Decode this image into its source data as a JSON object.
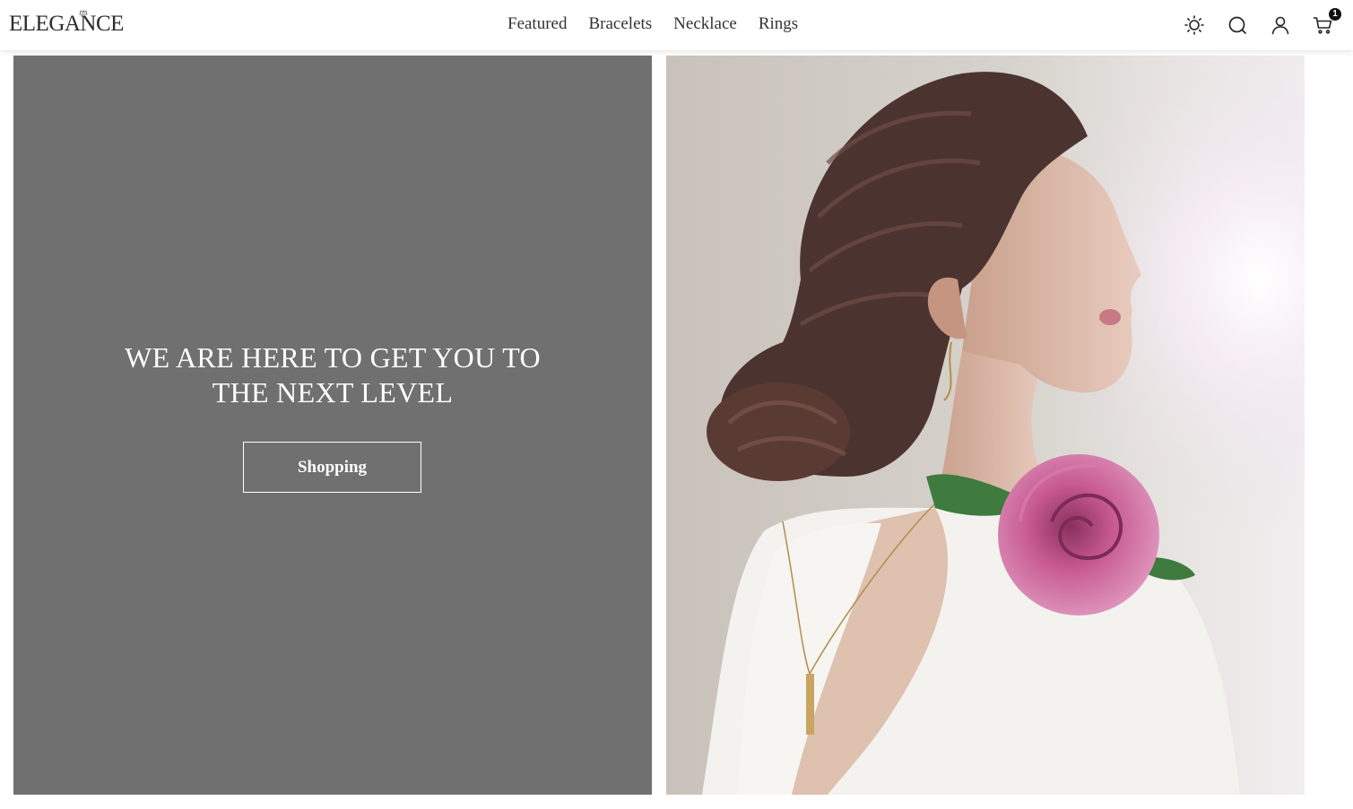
{
  "brand": {
    "logo_text": "ELEGANCE"
  },
  "nav": {
    "items": [
      {
        "label": "Featured"
      },
      {
        "label": "Bracelets"
      },
      {
        "label": "Necklace"
      },
      {
        "label": "Rings"
      }
    ]
  },
  "header_icons": {
    "theme": "sun-icon",
    "search": "search-icon",
    "account": "user-icon",
    "cart": "cart-icon",
    "cart_count": "1"
  },
  "hero": {
    "title": "WE ARE HERE TO GET YOU TO THE NEXT LEVEL",
    "button_label": "Shopping",
    "panel_color": "#717071"
  }
}
